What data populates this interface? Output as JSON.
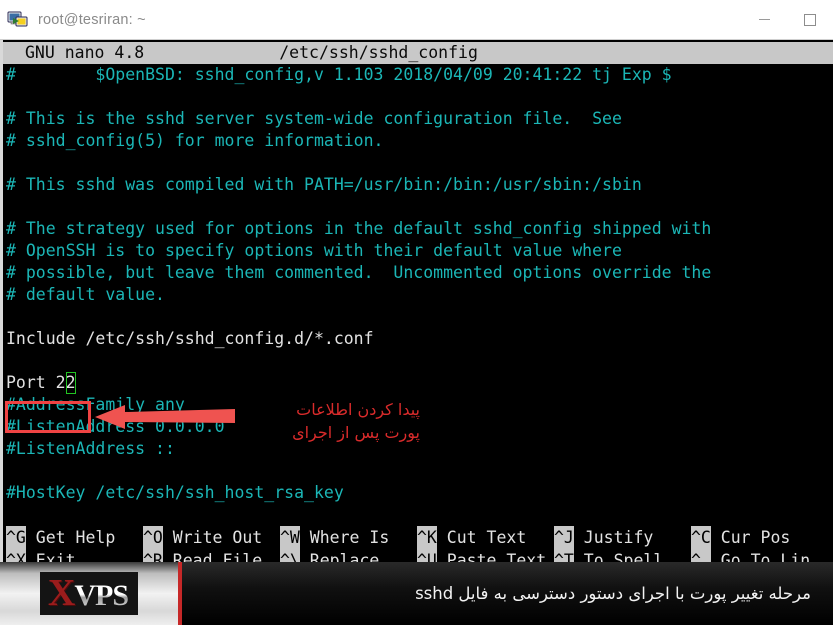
{
  "window": {
    "title": "root@tesriran: ~",
    "icon": "terminal-computer-icon",
    "minimize_label": "—",
    "maximize_label": "□"
  },
  "editor": {
    "name": "GNU nano 4.8",
    "filename": "/etc/ssh/sshd_config",
    "lines": [
      {
        "text": "#        $OpenBSD: sshd_config,v 1.103 2018/04/09 20:41:22 tj Exp $",
        "kind": "comment"
      },
      {
        "text": "",
        "kind": "blank"
      },
      {
        "text": "# This is the sshd server system-wide configuration file.  See",
        "kind": "comment"
      },
      {
        "text": "# sshd_config(5) for more information.",
        "kind": "comment"
      },
      {
        "text": "",
        "kind": "blank"
      },
      {
        "text": "# This sshd was compiled with PATH=/usr/bin:/bin:/usr/sbin:/sbin",
        "kind": "comment"
      },
      {
        "text": "",
        "kind": "blank"
      },
      {
        "text": "# The strategy used for options in the default sshd_config shipped with",
        "kind": "comment"
      },
      {
        "text": "# OpenSSH is to specify options with their default value where",
        "kind": "comment"
      },
      {
        "text": "# possible, but leave them commented.  Uncommented options override the",
        "kind": "comment"
      },
      {
        "text": "# default value.",
        "kind": "comment"
      },
      {
        "text": "",
        "kind": "blank"
      },
      {
        "text": "Include /etc/ssh/sshd_config.d/*.conf",
        "kind": "plain"
      },
      {
        "text": "",
        "kind": "blank"
      },
      {
        "text": "Port 22",
        "kind": "cursor-line",
        "prefix": "Port 2",
        "cursor_char": "2"
      },
      {
        "text": "#AddressFamily any",
        "kind": "comment"
      },
      {
        "text": "#ListenAddress 0.0.0.0",
        "kind": "comment"
      },
      {
        "text": "#ListenAddress ::",
        "kind": "comment"
      },
      {
        "text": "",
        "kind": "blank"
      },
      {
        "text": "#HostKey /etc/ssh/ssh_host_rsa_key",
        "kind": "comment"
      }
    ],
    "shortcuts": [
      {
        "key": "^G",
        "label": "Get Help"
      },
      {
        "key": "^O",
        "label": "Write Out"
      },
      {
        "key": "^W",
        "label": "Where Is"
      },
      {
        "key": "^K",
        "label": "Cut Text"
      },
      {
        "key": "^J",
        "label": "Justify"
      },
      {
        "key": "^C",
        "label": "Cur Pos"
      },
      {
        "key": "^X",
        "label": "Exit"
      },
      {
        "key": "^R",
        "label": "Read File"
      },
      {
        "key": "^\\",
        "label": "Replace"
      },
      {
        "key": "^U",
        "label": "Paste Text"
      },
      {
        "key": "^T",
        "label": "To Spell"
      },
      {
        "key": "^_",
        "label": "Go To Lin"
      }
    ]
  },
  "annotations": {
    "highlight_target": "Port 22",
    "arrow_direction": "left",
    "note_text": "پیدا کردن اطلاعات\nپورت پس از اجرای",
    "color": "#d92b2b",
    "arrow_color": "#ef5350",
    "box_color": "#ef4343",
    "cursor_color": "#22c422"
  },
  "banner": {
    "logo_x": "X",
    "logo_vps": "VPS",
    "caption": "مرحله تغییر پورت با اجرای دستور دسترسی به فایل sshd",
    "accent_color": "#c62828"
  }
}
